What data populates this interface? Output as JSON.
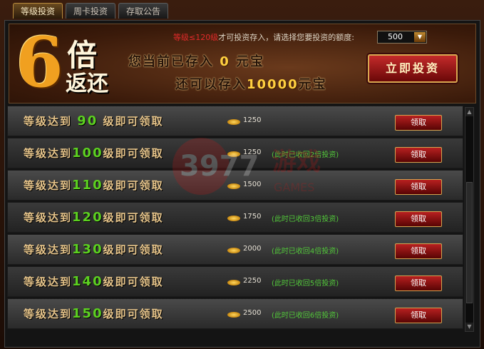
{
  "tabs": [
    {
      "label": "等级投资"
    },
    {
      "label": "周卡投资"
    },
    {
      "label": "存取公告"
    }
  ],
  "banner": {
    "multiplier": "6",
    "bei": "倍",
    "fanhuan": "返还",
    "hint_level": "等级≤120级",
    "hint_rest": "才可投资存入，请选择您要投资的额度:",
    "amount_selected": "500",
    "deposit_prefix": "您当前已存入",
    "deposit_value": "0",
    "deposit_unit": "元宝",
    "remain_prefix": "还可以存入",
    "remain_value": "10000",
    "remain_unit": "元宝",
    "invest_button": "立即投资"
  },
  "rows": [
    {
      "prefix": "等级达到",
      "level": "90",
      "suffix": "级即可领取",
      "amount": "1250",
      "note": "",
      "button": "领取"
    },
    {
      "prefix": "等级达到",
      "level": "100",
      "suffix": "级即可领取",
      "amount": "1250",
      "note": "(此时已收回2倍投资)",
      "button": "领取"
    },
    {
      "prefix": "等级达到",
      "level": "110",
      "suffix": "级即可领取",
      "amount": "1500",
      "note": "",
      "button": "领取"
    },
    {
      "prefix": "等级达到",
      "level": "120",
      "suffix": "级即可领取",
      "amount": "1750",
      "note": "(此时已收回3倍投资)",
      "button": "领取"
    },
    {
      "prefix": "等级达到",
      "level": "130",
      "suffix": "级即可领取",
      "amount": "2000",
      "note": "(此时已收回4倍投资)",
      "button": "领取"
    },
    {
      "prefix": "等级达到",
      "level": "140",
      "suffix": "级即可领取",
      "amount": "2250",
      "note": "(此时已收回5倍投资)",
      "button": "领取"
    },
    {
      "prefix": "等级达到",
      "level": "150",
      "suffix": "级即可领取",
      "amount": "2500",
      "note": "(此时已收回6倍投资)",
      "button": "领取"
    }
  ],
  "watermark": {
    "number": "3977",
    "cn": "游戏",
    "en": "GAMES"
  },
  "colors": {
    "gold": "#f0a020",
    "green_level": "#5cd020",
    "green_note": "#52c83a",
    "red_button": "#b82020"
  }
}
